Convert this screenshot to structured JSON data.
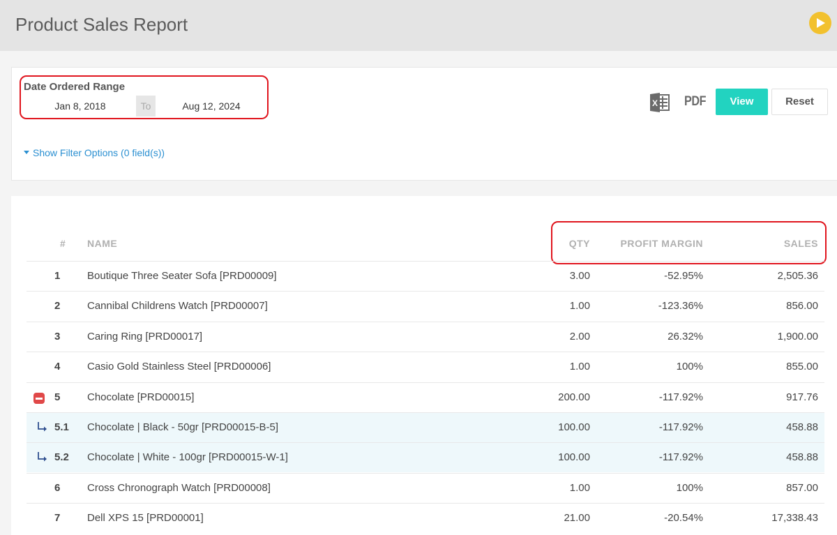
{
  "header": {
    "title": "Product Sales Report",
    "play_icon": "play-icon"
  },
  "filters": {
    "range_label": "Date Ordered Range",
    "date_from": "Jan 8, 2018",
    "to_label": "To",
    "date_to": "Aug 12, 2024",
    "toggle_label": "Show Filter Options (0 field(s))",
    "export_excel_icon": "excel-icon",
    "export_pdf_label": "PDF",
    "view_label": "View",
    "reset_label": "Reset"
  },
  "colors": {
    "accent": "#22d3c0",
    "link": "#2a8fd1",
    "highlight": "#e0141d",
    "play": "#f2c12e",
    "collapse": "#e04848"
  },
  "table": {
    "headers": {
      "num": "#",
      "name": "NAME",
      "qty": "QTY",
      "margin": "PROFIT MARGIN",
      "sales": "SALES"
    },
    "rows": [
      {
        "num": "1",
        "name": "Boutique Three Seater Sofa [PRD00009]",
        "qty": "3.00",
        "margin": "-52.95%",
        "sales": "2,505.36"
      },
      {
        "num": "2",
        "name": "Cannibal Childrens Watch [PRD00007]",
        "qty": "1.00",
        "margin": "-123.36%",
        "sales": "856.00"
      },
      {
        "num": "3",
        "name": "Caring Ring [PRD00017]",
        "qty": "2.00",
        "margin": "26.32%",
        "sales": "1,900.00"
      },
      {
        "num": "4",
        "name": "Casio Gold Stainless Steel [PRD00006]",
        "qty": "1.00",
        "margin": "100%",
        "sales": "855.00"
      },
      {
        "num": "5",
        "name": "Chocolate [PRD00015]",
        "qty": "200.00",
        "margin": "-117.92%",
        "sales": "917.76"
      },
      {
        "num": "5.1",
        "name": "Chocolate | Black - 50gr [PRD00015-B-5]",
        "qty": "100.00",
        "margin": "-117.92%",
        "sales": "458.88"
      },
      {
        "num": "5.2",
        "name": "Chocolate | White - 100gr [PRD00015-W-1]",
        "qty": "100.00",
        "margin": "-117.92%",
        "sales": "458.88"
      },
      {
        "num": "6",
        "name": "Cross Chronograph Watch [PRD00008]",
        "qty": "1.00",
        "margin": "100%",
        "sales": "857.00"
      },
      {
        "num": "7",
        "name": "Dell XPS 15 [PRD00001]",
        "qty": "21.00",
        "margin": "-20.54%",
        "sales": "17,338.43"
      }
    ]
  }
}
